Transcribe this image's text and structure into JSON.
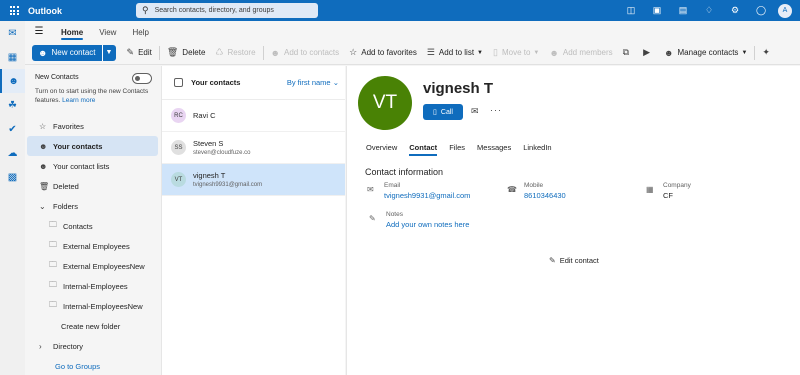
{
  "topbar": {
    "app_title": "Outlook",
    "search_placeholder": "Search contacts, directory, and groups",
    "avatar_initial": "A"
  },
  "ribbon": {
    "tabs": [
      "Home",
      "View",
      "Help"
    ],
    "active_tab": "Home",
    "new_contact": "New contact",
    "edit": "Edit",
    "delete": "Delete",
    "restore": "Restore",
    "add_to_contacts": "Add to contacts",
    "add_to_favorites": "Add to favorites",
    "add_to_list": "Add to list",
    "move_to": "Move to",
    "add_members": "Add members",
    "manage_contacts": "Manage contacts"
  },
  "folders": {
    "notice_title": "New Contacts",
    "notice_text": "Turn on to start using the new Contacts features.",
    "notice_link": "Learn more",
    "items": [
      {
        "label": "Favorites"
      },
      {
        "label": "Your contacts"
      },
      {
        "label": "Your contact lists"
      },
      {
        "label": "Deleted"
      },
      {
        "label": "Folders"
      },
      {
        "label": "Contacts"
      },
      {
        "label": "External Employees"
      },
      {
        "label": "External EmployeesNew"
      },
      {
        "label": "Internal-Employees"
      },
      {
        "label": "Internal-EmployeesNew"
      },
      {
        "label": "Create new folder"
      },
      {
        "label": "Directory"
      },
      {
        "label": "Go to Groups"
      }
    ]
  },
  "list": {
    "title": "Your contacts",
    "sort": "By first name",
    "contacts": [
      {
        "initials": "RC",
        "name": "Ravi C",
        "email": ""
      },
      {
        "initials": "SS",
        "name": "Steven S",
        "email": "steven@cloudfuze.co"
      },
      {
        "initials": "VT",
        "name": "vignesh T",
        "email": "tvignesh9931@gmail.com"
      }
    ]
  },
  "detail": {
    "initials": "VT",
    "name": "vignesh T",
    "call": "Call",
    "tabs": [
      "Overview",
      "Contact",
      "Files",
      "Messages",
      "LinkedIn"
    ],
    "active_tab": "Contact",
    "section_title": "Contact information",
    "email_label": "Email",
    "email": "tvignesh9931@gmail.com",
    "mobile_label": "Mobile",
    "mobile": "8610346430",
    "company_label": "Company",
    "company": "CF",
    "notes_label": "Notes",
    "notes_link": "Add your own notes here",
    "edit_contact": "Edit contact"
  },
  "colors": {
    "brand": "#0f6cbd",
    "avatar_green": "#498205",
    "selected_row": "#cfe4fa"
  }
}
